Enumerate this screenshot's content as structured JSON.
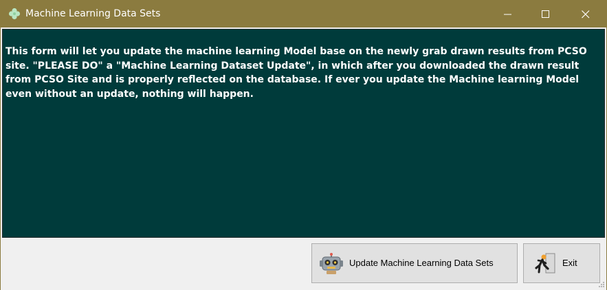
{
  "window": {
    "title": "Machine Learning Data Sets",
    "app_icon": "clover-icon",
    "controls": [
      "minimize-icon",
      "maximize-icon",
      "close-icon"
    ]
  },
  "main": {
    "message": "This form will let you update the machine learning Model base on the newly grab drawn results from PCSO site. \"PLEASE DO\" a \"Machine Learning Dataset Update\", in which after you downloaded the drawn result from PCSO Site and is properly reflected on the database. If ever you update the Machine learning Model even without an update, nothing will happen."
  },
  "footer": {
    "update_button": {
      "label": "Update Machine Learning Data Sets",
      "icon": "robot-icon"
    },
    "exit_button": {
      "label": "Exit",
      "icon": "exit-running-icon"
    }
  },
  "colors": {
    "titlebar": "#8b7b3f",
    "panel": "#003b3b",
    "button_face": "#e1e1e1"
  }
}
